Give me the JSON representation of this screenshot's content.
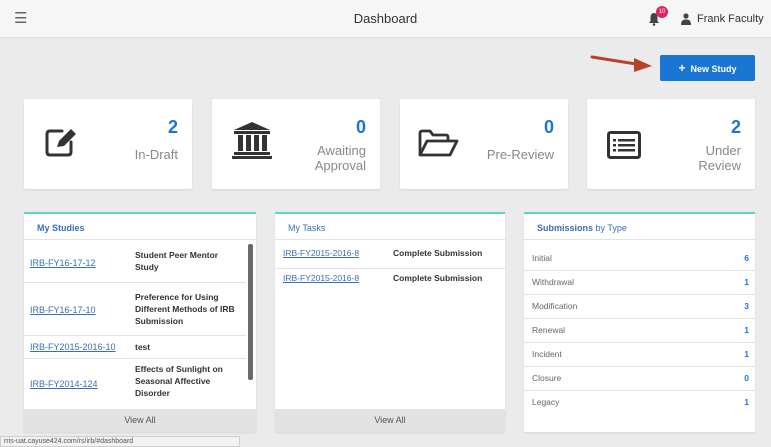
{
  "topbar": {
    "menu_icon": "hamburger-icon",
    "title": "Dashboard",
    "notifications": {
      "icon": "bell-icon",
      "count": "10"
    },
    "user": {
      "icon": "user-icon",
      "name": "Frank Faculty"
    }
  },
  "actions": {
    "new_study_icon": "plus-icon",
    "new_study_label": "New Study",
    "accent": "#1976d2",
    "arrow_color": "#b5432a"
  },
  "stats": [
    {
      "icon": "edit-icon",
      "count": "2",
      "label": "In-Draft"
    },
    {
      "icon": "institution-icon",
      "count": "0",
      "label_line1": "Awaiting",
      "label_line2": "Approval"
    },
    {
      "icon": "folder-open-icon",
      "count": "0",
      "label": "Pre-Review"
    },
    {
      "icon": "list-icon",
      "count": "2",
      "label_line1": "Under",
      "label_line2": "Review"
    }
  ],
  "my_studies": {
    "title": "My Studies",
    "rows": [
      {
        "id": "IRB-FY16-17-12",
        "title": "Student Peer Mentor Study"
      },
      {
        "id": "IRB-FY16-17-10",
        "title": "Preference for Using Different Methods of IRB Submission"
      },
      {
        "id": "IRB-FY2015-2016-10",
        "title": "test"
      },
      {
        "id": "IRB-FY2014-124",
        "title": "Effects of Sunlight on Seasonal Affective Disorder"
      }
    ],
    "view_all": "View All"
  },
  "my_tasks": {
    "title": "My Tasks",
    "rows": [
      {
        "id": "IRB-FY2015-2016-8",
        "action": "Complete Submission"
      },
      {
        "id": "IRB-FY2015-2016-8",
        "action": "Complete Submission"
      }
    ],
    "view_all": "View All"
  },
  "submissions": {
    "title_strong": "Submissions",
    "title_rest": " by Type",
    "rows": [
      {
        "type": "Initial",
        "count": "6"
      },
      {
        "type": "Withdrawal",
        "count": "1"
      },
      {
        "type": "Modification",
        "count": "3"
      },
      {
        "type": "Renewal",
        "count": "1"
      },
      {
        "type": "Incident",
        "count": "1"
      },
      {
        "type": "Closure",
        "count": "0"
      },
      {
        "type": "Legacy",
        "count": "1"
      }
    ]
  },
  "statusbar": {
    "url": "rris-uat.cayuse424.com/rs/irb/#dashboard"
  }
}
